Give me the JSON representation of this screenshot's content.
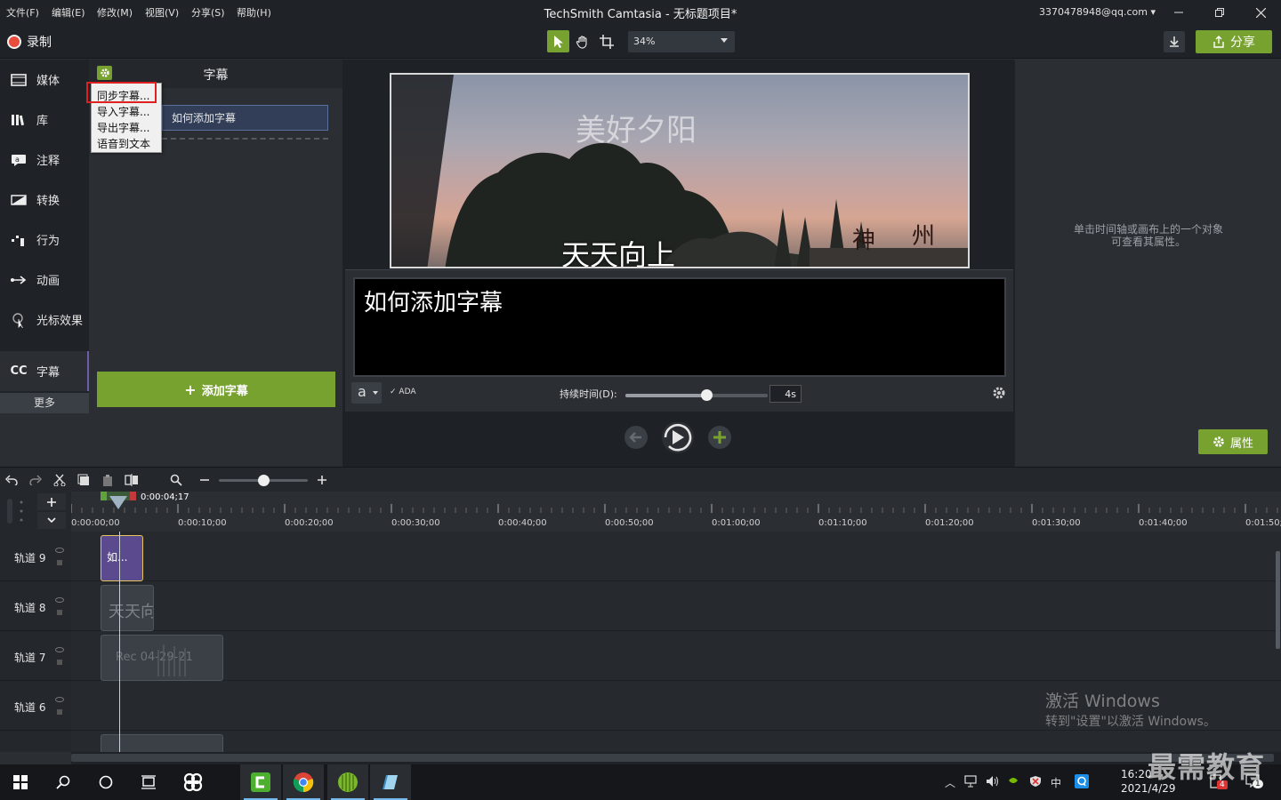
{
  "menu": [
    "文件(F)",
    "编辑(E)",
    "修改(M)",
    "视图(V)",
    "分享(S)",
    "帮助(H)"
  ],
  "app_title": "TechSmith Camtasia - 无标题项目*",
  "account": "3370478948@qq.com",
  "toolbar": {
    "record": "录制",
    "zoom": "34%",
    "share": "分享"
  },
  "sidebar": {
    "items": [
      {
        "label": "媒体",
        "icon": "filmstrip-icon"
      },
      {
        "label": "库",
        "icon": "library-icon"
      },
      {
        "label": "注释",
        "icon": "annotation-icon"
      },
      {
        "label": "转换",
        "icon": "transition-icon"
      },
      {
        "label": "行为",
        "icon": "behavior-icon"
      },
      {
        "label": "动画",
        "icon": "animation-icon"
      },
      {
        "label": "光标效果",
        "icon": "cursor-effect-icon"
      },
      {
        "label": "字幕",
        "icon": "cc-icon"
      }
    ],
    "more": "更多"
  },
  "captions_panel": {
    "title": "字幕",
    "item": "如何添加字幕",
    "add_button": "添加字幕",
    "menu": [
      "同步字幕...",
      "导入字幕...",
      "导出字幕...",
      "语音到文本"
    ]
  },
  "canvas": {
    "video_title": "美好夕阳",
    "video_subtitle": "天天向上",
    "caption_text": "如何添加字幕",
    "font_button": "a",
    "ada": "ADA",
    "duration_label": "持续时间(D):",
    "duration_value": "4s",
    "duration_slider_fraction": 0.57
  },
  "properties": {
    "hint_line1": "单击时间轴或画布上的一个对象",
    "hint_line2": "可查看其属性。",
    "button": "属性"
  },
  "timeline": {
    "playhead_time": "0:00:04;17",
    "ticks": [
      "0:00:00;00",
      "0:00:10;00",
      "0:00:20;00",
      "0:00:30;00",
      "0:00:40;00",
      "0:00:50;00",
      "0:01:00;00",
      "0:01:10;00",
      "0:01:20;00",
      "0:01:30;00",
      "0:01:40;00",
      "0:01:50;"
    ],
    "zoom_fraction": 0.5,
    "tracks": [
      {
        "name": "轨道 9",
        "clip": "如..."
      },
      {
        "name": "轨道 8",
        "clip": "天天向"
      },
      {
        "name": "轨道 7",
        "clip": "Rec 04-29-21"
      },
      {
        "name": "轨道 6",
        "clip": ""
      }
    ]
  },
  "watermark": {
    "activate_title": "激活 Windows",
    "activate_sub": "转到\"设置\"以激活 Windows。",
    "brand": "最需教育"
  },
  "taskbar": {
    "time": "16:20",
    "date": "2021/4/29",
    "ime": "中",
    "notif_badge": "4",
    "action_badge": "1"
  },
  "colors": {
    "accent_green": "#78a22f",
    "record_red": "#e74c3c",
    "caption_clip": "#5c4a8e"
  }
}
